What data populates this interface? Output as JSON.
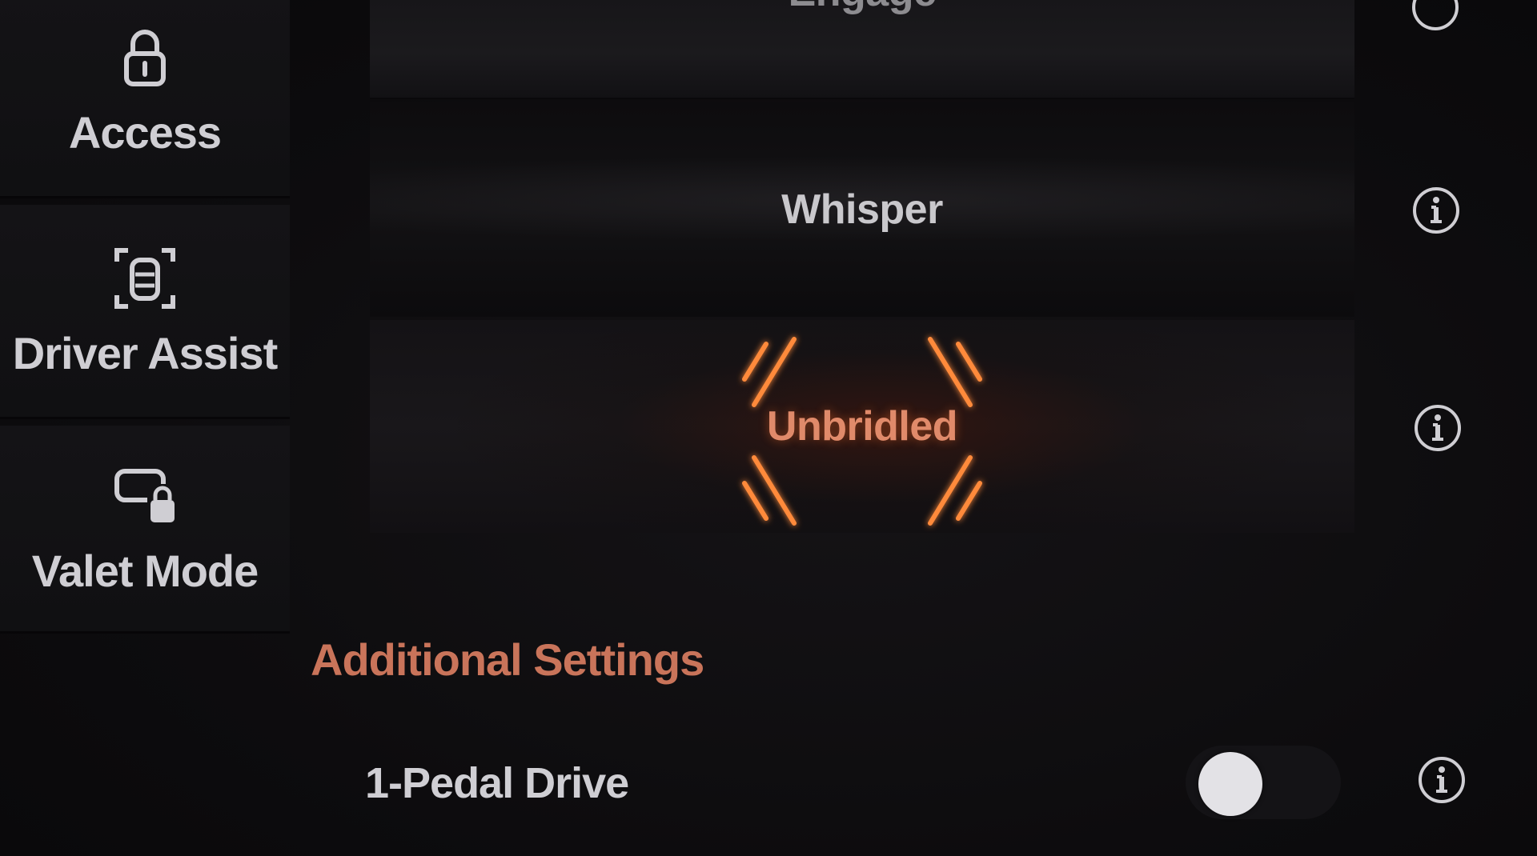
{
  "sidebar": {
    "items": [
      {
        "label": "Access",
        "icon": "lock-icon"
      },
      {
        "label": "Driver Assist",
        "icon": "car-sensor-icon"
      },
      {
        "label": "Valet Mode",
        "icon": "valet-lock-icon"
      }
    ]
  },
  "drive_modes": {
    "items": [
      {
        "label": "Engage",
        "icon": "info-icon"
      },
      {
        "label": "Whisper",
        "icon": "info-icon"
      },
      {
        "label": "Unbridled",
        "icon": "info-icon",
        "selected": true
      }
    ]
  },
  "additional_settings": {
    "title": "Additional Settings",
    "one_pedal_drive": {
      "label": "1-Pedal Drive",
      "enabled": false
    }
  },
  "colors": {
    "accent": "#c9745a",
    "unbridled_glow": "#ff7a2a",
    "text": "#cfced3"
  }
}
